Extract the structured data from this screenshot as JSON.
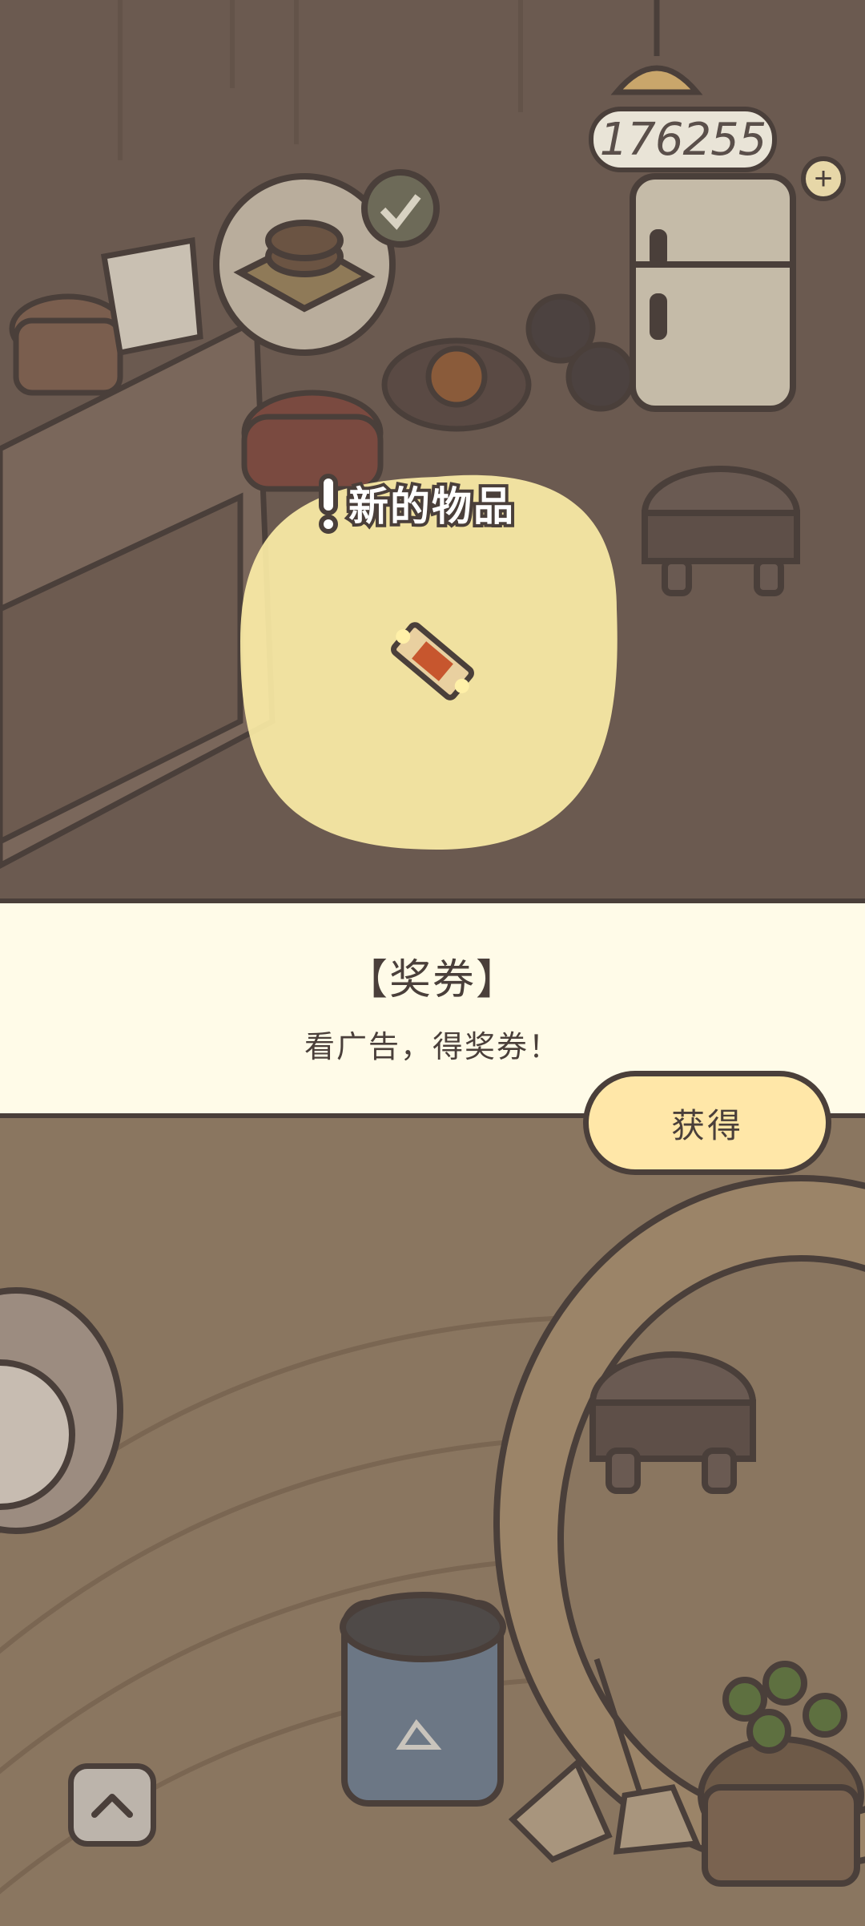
{
  "hud": {
    "coin_count": "176255",
    "add_coins_icon": "plus-icon"
  },
  "popup": {
    "title": "新的物品",
    "item_icon": "ticket-icon"
  },
  "item_panel": {
    "name": "【奖券】",
    "description": "看广告，得奖券！",
    "obtain_label": "获得"
  },
  "controls": {
    "collapse_icon": "chevron-up-icon"
  },
  "colors": {
    "outline": "#4a3f3a",
    "panel_bg": "#fffbe8",
    "button_bg": "#ffe7a8",
    "glow": "#fff0a8"
  }
}
